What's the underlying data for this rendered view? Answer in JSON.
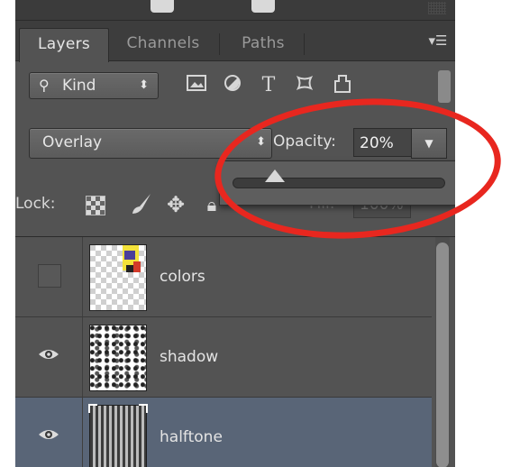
{
  "tabs": [
    {
      "label": "Layers",
      "active": true
    },
    {
      "label": "Channels",
      "active": false
    },
    {
      "label": "Paths",
      "active": false
    }
  ],
  "panel_menu_icon": "panel-menu-icon",
  "filter": {
    "kind_label": "Kind",
    "icons": [
      "image-filter-icon",
      "adjustment-filter-icon",
      "type-filter-icon",
      "shape-filter-icon",
      "smart-object-filter-icon"
    ],
    "type_glyph": "T"
  },
  "blend": {
    "mode": "Overlay",
    "opacity_label": "Opacity:",
    "opacity_value": "20%",
    "slider_fraction": 0.2
  },
  "lock": {
    "label": "Lock:",
    "icons": [
      "lock-transparent-pixels-icon",
      "lock-image-pixels-icon",
      "lock-position-icon",
      "lock-all-icon"
    ],
    "fill_label": "Fill:",
    "fill_value": "100%"
  },
  "layers": [
    {
      "name": "colors",
      "visible": false,
      "selected": false
    },
    {
      "name": "shadow",
      "visible": true,
      "selected": false
    },
    {
      "name": "halftone",
      "visible": true,
      "selected": true
    }
  ],
  "colors": {
    "panel_bg": "#535353",
    "selected_row": "#596577",
    "annotation": "#e8271f"
  }
}
